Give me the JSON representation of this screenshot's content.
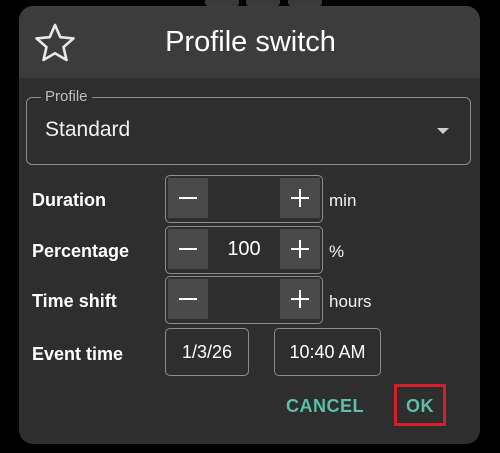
{
  "dialog": {
    "title": "Profile switch",
    "icon": "star-icon"
  },
  "profile": {
    "label": "Profile",
    "value": "Standard"
  },
  "rows": {
    "duration": {
      "label": "Duration",
      "value": "",
      "unit": "min"
    },
    "percentage": {
      "label": "Percentage",
      "value": "100",
      "unit": "%"
    },
    "time_shift": {
      "label": "Time shift",
      "value": "",
      "unit": "hours"
    },
    "event_time": {
      "label": "Event time",
      "date": "1/3/26",
      "time": "10:40 AM"
    }
  },
  "actions": {
    "cancel": "CANCEL",
    "ok": "OK"
  },
  "colors": {
    "accent": "#5bbfa8",
    "highlight": "#d5202c",
    "dialog_bg": "#2e2e2e",
    "header_bg": "#3c3c3c"
  }
}
